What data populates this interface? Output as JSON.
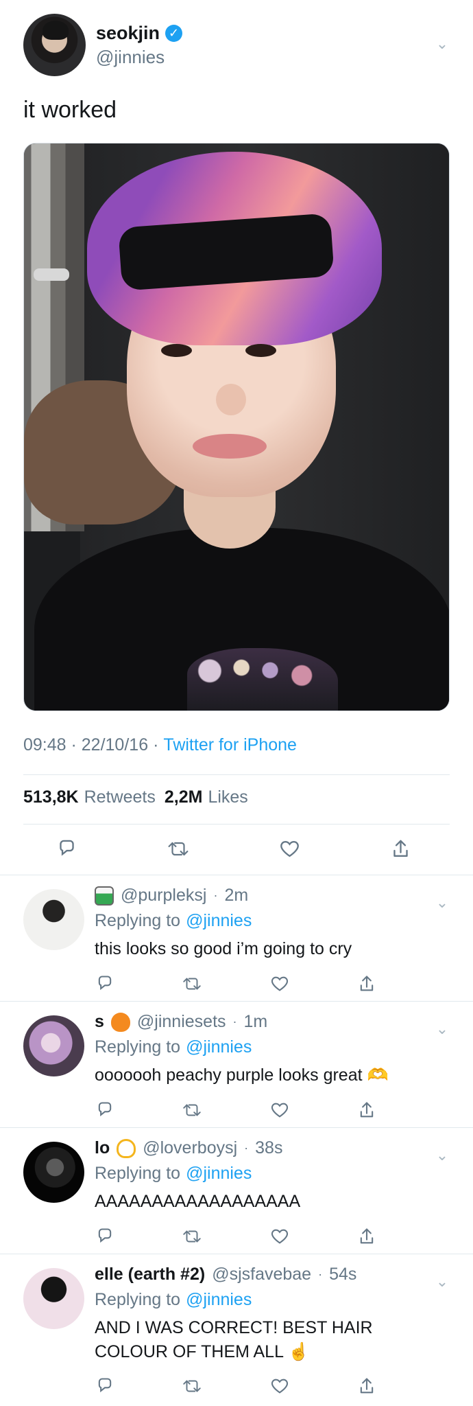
{
  "main": {
    "display_name": "seokjin",
    "verified_icon": "verified-badge-icon",
    "handle": "@jinnies",
    "text": "it worked",
    "timestamp": "09:48 · 22/10/16",
    "source_separator": "·",
    "source": "Twitter for iPhone",
    "retweets": "513,8K",
    "retweets_label": "Retweets",
    "likes": "2,2M",
    "likes_label": "Likes"
  },
  "replies": [
    {
      "name": "",
      "emoji": "juice-box-emoji",
      "handle": "@purpleksj",
      "dot": "·",
      "time": "2m",
      "replying_label": "Replying to",
      "mention": "@jinnies",
      "text": "this looks so good i’m going to cry"
    },
    {
      "name": "s",
      "emoji": "orange-heart-emoji",
      "handle": "@jinniesets",
      "dot": "·",
      "time": "1m",
      "replying_label": "Replying to",
      "mention": "@jinnies",
      "text": "ooooooh peachy purple looks great 🫶"
    },
    {
      "name": "lo",
      "emoji": "heart-hands-emoji",
      "handle": "@loverboysj",
      "dot": "·",
      "time": "38s",
      "replying_label": "Replying to",
      "mention": "@jinnies",
      "text": "AAAAAAAAAAAAAAAAAA"
    },
    {
      "name": "elle (earth #2)",
      "emoji": "",
      "handle": "@sjsfavebae",
      "dot": "·",
      "time": "54s",
      "replying_label": "Replying to",
      "mention": "@jinnies",
      "text": "AND I WAS CORRECT! BEST HAIR COLOUR OF THEM ALL ☝️"
    }
  ],
  "colors": {
    "link": "#1da1f2",
    "secondary_text": "#657786",
    "divider": "#e1e8ed"
  }
}
